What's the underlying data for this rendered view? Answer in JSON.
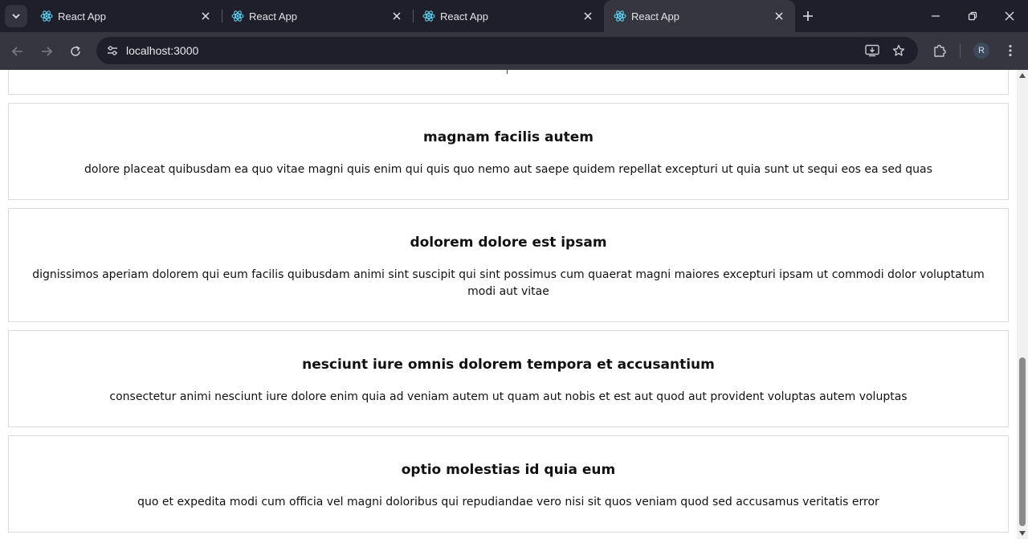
{
  "browser": {
    "tabs": [
      {
        "title": "React App",
        "active": false
      },
      {
        "title": "React App",
        "active": false
      },
      {
        "title": "React App",
        "active": false
      },
      {
        "title": "React App",
        "active": true
      }
    ],
    "address_bar": {
      "url": "localhost:3000"
    },
    "profile_initial": "R",
    "icons": {
      "tab_search": "chevron-down-icon",
      "favicon": "react-logo-icon",
      "new_tab": "plus-icon",
      "back": "arrow-left-icon",
      "forward": "arrow-right-icon",
      "reload": "reload-icon",
      "site_info": "tune-icon",
      "install": "install-app-icon",
      "bookmark": "star-icon",
      "extensions": "puzzle-icon",
      "menu": "kebab-menu-icon"
    },
    "colors": {
      "tabstrip_bg": "#1f1f2b",
      "toolbar_bg": "#35363f",
      "react_blue": "#61dafb",
      "icon_color": "#c7c7cc"
    }
  },
  "page": {
    "posts": [
      {
        "title": "magnam facilis autem",
        "body": "dolore placeat quibusdam ea quo vitae magni quis enim qui quis quo nemo aut saepe quidem repellat excepturi ut quia sunt ut sequi eos ea sed quas"
      },
      {
        "title": "dolorem dolore est ipsam",
        "body": "dignissimos aperiam dolorem qui eum facilis quibusdam animi sint suscipit qui sint possimus cum quaerat magni maiores excepturi ipsam ut commodi dolor voluptatum modi aut vitae"
      },
      {
        "title": "nesciunt iure omnis dolorem tempora et accusantium",
        "body": "consectetur animi nesciunt iure dolore enim quia ad veniam autem ut quam aut nobis et est aut quod aut provident voluptas autem voluptas"
      },
      {
        "title": "optio molestias id quia eum",
        "body": "quo et expedita modi cum officia vel magni doloribus qui repudiandae vero nisi sit quos veniam quod sed accusamus veritatis error"
      }
    ]
  }
}
